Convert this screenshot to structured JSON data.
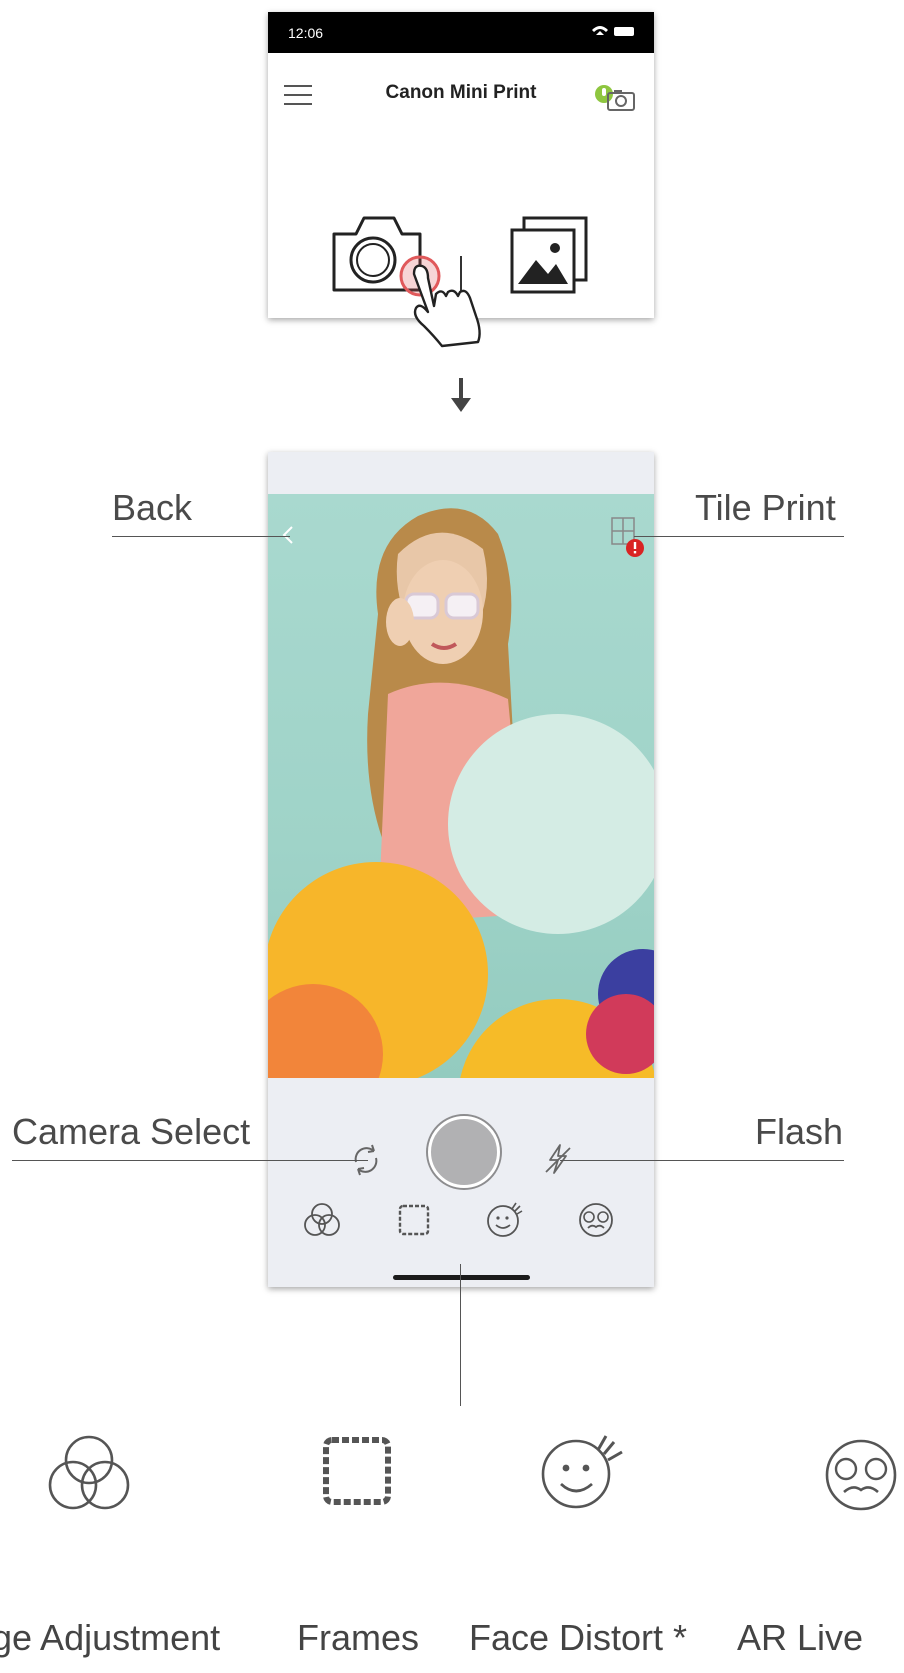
{
  "top_screen": {
    "status_time": "12:06",
    "title": "Canon Mini Print",
    "icons": [
      "menu-icon",
      "printer-connected-icon",
      "camera-icon",
      "gallery-icon",
      "tap-hand-icon"
    ]
  },
  "camera_screen": {
    "icons": [
      "back-icon",
      "tile-print-icon",
      "camera-select-icon",
      "shutter-button",
      "flash-icon",
      "image-adjustment-icon",
      "frames-icon",
      "face-distort-icon",
      "ar-live-icon"
    ]
  },
  "callouts": {
    "back": "Back",
    "tile_print": "Tile Print",
    "camera_select": "Camera Select",
    "flash": "Flash"
  },
  "bottom_labels": {
    "image_adjustment": "ge Adjustment",
    "frames": "Frames",
    "face_distort": "Face Distort *",
    "ar_live": "AR Live"
  },
  "colors": {
    "accent_badge": "#d92323",
    "tap_ring": "#e0595b",
    "photo_background": "#a9d9cf"
  }
}
